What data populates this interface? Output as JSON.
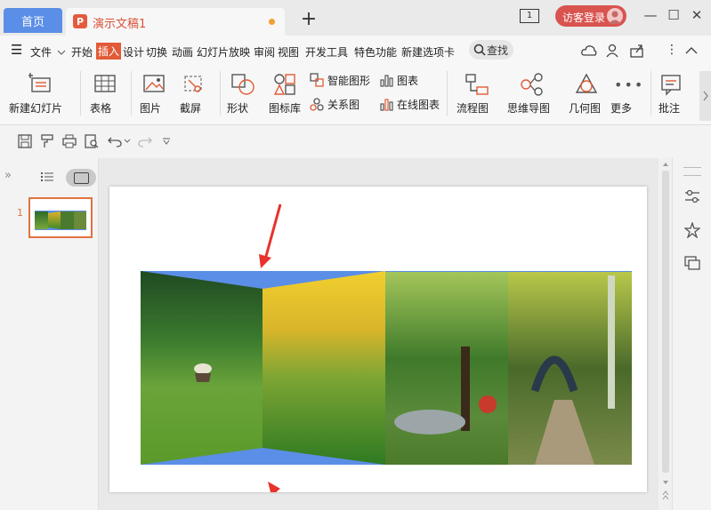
{
  "tabs": {
    "home": "首页",
    "doc_title": "演示文稿1",
    "doc_icon": "P",
    "new_tab": "+"
  },
  "titlebar": {
    "page_count": "1",
    "login": "访客登录",
    "minimize": "—",
    "maximize": "☐",
    "close": "✕"
  },
  "menu": {
    "hamburger": "☰",
    "file": "文件",
    "items": [
      "开始",
      "插入",
      "设计",
      "切换",
      "动画",
      "幻灯片放映",
      "审阅",
      "视图",
      "开发工具",
      "特色功能",
      "新建选项卡"
    ],
    "search": "查找"
  },
  "ribbon": {
    "new_slide": "新建幻灯片",
    "table": "表格",
    "picture": "图片",
    "screenshot": "截屏",
    "shape": "形状",
    "icon_lib": "图标库",
    "smart_graphic": "智能图形",
    "relation": "关系图",
    "chart": "图表",
    "online_chart": "在线图表",
    "flowchart": "流程图",
    "mindmap": "思维导图",
    "geometry": "几何图",
    "more": "更多",
    "comment": "批注"
  },
  "thumbnail": {
    "number": "1"
  },
  "colors": {
    "accent": "#e15b37",
    "home_tab": "#5b8ee6",
    "login": "#d9534f",
    "arrow": "#e8322c",
    "blue_shape": "#5b8ee6"
  }
}
